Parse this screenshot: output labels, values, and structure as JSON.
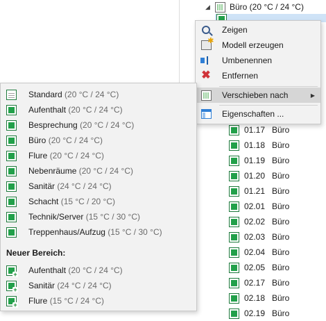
{
  "tree": {
    "top": {
      "caret": "◢",
      "label": "Büro (20 °C / 24 °C)"
    },
    "rows": [
      {
        "num": "01.17",
        "name": "Büro"
      },
      {
        "num": "01.18",
        "name": "Büro"
      },
      {
        "num": "01.19",
        "name": "Büro"
      },
      {
        "num": "01.20",
        "name": "Büro"
      },
      {
        "num": "01.21",
        "name": "Büro"
      },
      {
        "num": "02.01",
        "name": "Büro"
      },
      {
        "num": "02.02",
        "name": "Büro"
      },
      {
        "num": "02.03",
        "name": "Büro"
      },
      {
        "num": "02.04",
        "name": "Büro"
      },
      {
        "num": "02.05",
        "name": "Büro"
      },
      {
        "num": "02.17",
        "name": "Büro"
      },
      {
        "num": "02.18",
        "name": "Büro"
      },
      {
        "num": "02.19",
        "name": "Büro"
      }
    ]
  },
  "context_menu": {
    "items": [
      {
        "label": "Zeigen",
        "icon": "magnifier-icon"
      },
      {
        "label": "Modell erzeugen",
        "icon": "create-model-icon"
      },
      {
        "label": "Umbenennen",
        "icon": "rename-icon"
      },
      {
        "label": "Entfernen",
        "icon": "delete-icon"
      },
      {
        "label": "Verschieben nach",
        "icon": "move-to-icon",
        "submenu_arrow": "▶"
      },
      {
        "label": "Eigenschaften ...",
        "icon": "properties-icon"
      }
    ]
  },
  "submenu": {
    "items": [
      {
        "name": "Standard",
        "temp": "(20 °C / 24 °C)"
      },
      {
        "name": "Aufenthalt",
        "temp": "(20 °C / 24 °C)"
      },
      {
        "name": "Besprechung",
        "temp": "(20 °C / 24 °C)"
      },
      {
        "name": "Büro",
        "temp": "(20 °C / 24 °C)"
      },
      {
        "name": "Flure",
        "temp": "(20 °C / 24 °C)"
      },
      {
        "name": "Nebenräume",
        "temp": "(20 °C / 24 °C)"
      },
      {
        "name": "Sanitär",
        "temp": "(24 °C / 24 °C)"
      },
      {
        "name": "Schacht",
        "temp": "(15 °C / 20 °C)"
      },
      {
        "name": "Technik/Server",
        "temp": "(15 °C / 30 °C)"
      },
      {
        "name": "Treppenhaus/Aufzug",
        "temp": "(15 °C / 30 °C)"
      }
    ],
    "new_area_header": "Neuer Bereich:",
    "new_items": [
      {
        "name": "Aufenthalt",
        "temp": "(20 °C / 24 °C)"
      },
      {
        "name": "Sanitär",
        "temp": "(24 °C / 24 °C)"
      },
      {
        "name": "Flure",
        "temp": "(15 °C / 24 °C)"
      }
    ]
  }
}
